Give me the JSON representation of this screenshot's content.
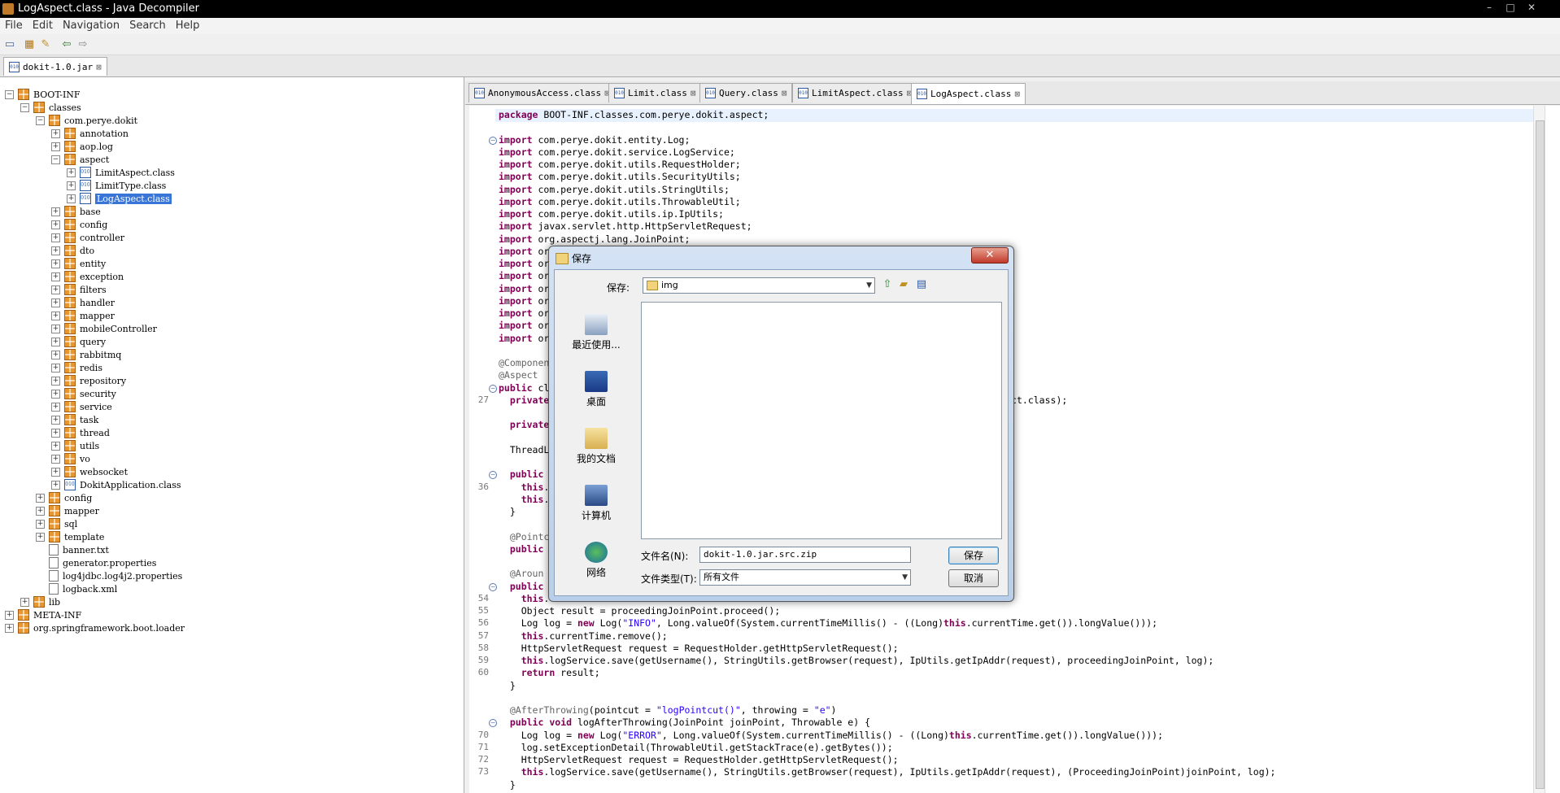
{
  "window": {
    "title": "LogAspect.class - Java Decompiler"
  },
  "menu": [
    "File",
    "Edit",
    "Navigation",
    "Search",
    "Help"
  ],
  "jar_tab": {
    "label": "dokit-1.0.jar"
  },
  "tree": [
    {
      "label": "BOOT-INF",
      "level": 0,
      "expanded": true,
      "kind": "package"
    },
    {
      "label": "classes",
      "level": 1,
      "expanded": true,
      "kind": "package"
    },
    {
      "label": "com.perye.dokit",
      "level": 2,
      "expanded": true,
      "kind": "package"
    },
    {
      "label": "annotation",
      "level": 3,
      "expanded": false,
      "kind": "package"
    },
    {
      "label": "aop.log",
      "level": 3,
      "expanded": false,
      "kind": "package"
    },
    {
      "label": "aspect",
      "level": 3,
      "expanded": true,
      "kind": "package"
    },
    {
      "label": "LimitAspect.class",
      "level": 4,
      "expanded": false,
      "kind": "class"
    },
    {
      "label": "LimitType.class",
      "level": 4,
      "expanded": false,
      "kind": "class"
    },
    {
      "label": "LogAspect.class",
      "level": 4,
      "expanded": false,
      "kind": "class",
      "selected": true
    },
    {
      "label": "base",
      "level": 3,
      "expanded": false,
      "kind": "package"
    },
    {
      "label": "config",
      "level": 3,
      "expanded": false,
      "kind": "package"
    },
    {
      "label": "controller",
      "level": 3,
      "expanded": false,
      "kind": "package"
    },
    {
      "label": "dto",
      "level": 3,
      "expanded": false,
      "kind": "package"
    },
    {
      "label": "entity",
      "level": 3,
      "expanded": false,
      "kind": "package"
    },
    {
      "label": "exception",
      "level": 3,
      "expanded": false,
      "kind": "package"
    },
    {
      "label": "filters",
      "level": 3,
      "expanded": false,
      "kind": "package"
    },
    {
      "label": "handler",
      "level": 3,
      "expanded": false,
      "kind": "package"
    },
    {
      "label": "mapper",
      "level": 3,
      "expanded": false,
      "kind": "package"
    },
    {
      "label": "mobileController",
      "level": 3,
      "expanded": false,
      "kind": "package"
    },
    {
      "label": "query",
      "level": 3,
      "expanded": false,
      "kind": "package"
    },
    {
      "label": "rabbitmq",
      "level": 3,
      "expanded": false,
      "kind": "package"
    },
    {
      "label": "redis",
      "level": 3,
      "expanded": false,
      "kind": "package"
    },
    {
      "label": "repository",
      "level": 3,
      "expanded": false,
      "kind": "package"
    },
    {
      "label": "security",
      "level": 3,
      "expanded": false,
      "kind": "package"
    },
    {
      "label": "service",
      "level": 3,
      "expanded": false,
      "kind": "package"
    },
    {
      "label": "task",
      "level": 3,
      "expanded": false,
      "kind": "package"
    },
    {
      "label": "thread",
      "level": 3,
      "expanded": false,
      "kind": "package"
    },
    {
      "label": "utils",
      "level": 3,
      "expanded": false,
      "kind": "package"
    },
    {
      "label": "vo",
      "level": 3,
      "expanded": false,
      "kind": "package"
    },
    {
      "label": "websocket",
      "level": 3,
      "expanded": false,
      "kind": "package"
    },
    {
      "label": "DokitApplication.class",
      "level": 3,
      "expanded": false,
      "kind": "class"
    },
    {
      "label": "config",
      "level": 2,
      "expanded": false,
      "kind": "package"
    },
    {
      "label": "mapper",
      "level": 2,
      "expanded": false,
      "kind": "package"
    },
    {
      "label": "sql",
      "level": 2,
      "expanded": false,
      "kind": "package"
    },
    {
      "label": "template",
      "level": 2,
      "expanded": false,
      "kind": "package"
    },
    {
      "label": "banner.txt",
      "level": 2,
      "kind": "file"
    },
    {
      "label": "generator.properties",
      "level": 2,
      "kind": "file"
    },
    {
      "label": "log4jdbc.log4j2.properties",
      "level": 2,
      "kind": "file"
    },
    {
      "label": "logback.xml",
      "level": 2,
      "kind": "file"
    },
    {
      "label": "lib",
      "level": 1,
      "expanded": false,
      "kind": "package"
    },
    {
      "label": "META-INF",
      "level": 0,
      "expanded": false,
      "kind": "package"
    },
    {
      "label": "org.springframework.boot.loader",
      "level": 0,
      "expanded": false,
      "kind": "package"
    }
  ],
  "editor_tabs": [
    {
      "label": "AnonymousAccess.class",
      "active": false
    },
    {
      "label": "Limit.class",
      "active": false
    },
    {
      "label": "Query.class",
      "active": false
    },
    {
      "label": "LimitAspect.class",
      "active": false
    },
    {
      "label": "LogAspect.class",
      "active": true
    }
  ],
  "code": [
    {
      "ln": "",
      "fold": false,
      "text": "package BOOT-INF.classes.com.perye.dokit.aspect;"
    },
    {
      "ln": "",
      "fold": false,
      "text": ""
    },
    {
      "ln": "",
      "fold": true,
      "text": "import com.perye.dokit.entity.Log;"
    },
    {
      "ln": "",
      "fold": false,
      "text": "import com.perye.dokit.service.LogService;"
    },
    {
      "ln": "",
      "fold": false,
      "text": "import com.perye.dokit.utils.RequestHolder;"
    },
    {
      "ln": "",
      "fold": false,
      "text": "import com.perye.dokit.utils.SecurityUtils;"
    },
    {
      "ln": "",
      "fold": false,
      "text": "import com.perye.dokit.utils.StringUtils;"
    },
    {
      "ln": "",
      "fold": false,
      "text": "import com.perye.dokit.utils.ThrowableUtil;"
    },
    {
      "ln": "",
      "fold": false,
      "text": "import com.perye.dokit.utils.ip.IpUtils;"
    },
    {
      "ln": "",
      "fold": false,
      "text": "import javax.servlet.http.HttpServletRequest;"
    },
    {
      "ln": "",
      "fold": false,
      "text": "import org.aspectj.lang.JoinPoint;"
    },
    {
      "ln": "",
      "fold": false,
      "text": "import or"
    },
    {
      "ln": "",
      "fold": false,
      "text": "import or"
    },
    {
      "ln": "",
      "fold": false,
      "text": "import or"
    },
    {
      "ln": "",
      "fold": false,
      "text": "import or"
    },
    {
      "ln": "",
      "fold": false,
      "text": "import or"
    },
    {
      "ln": "",
      "fold": false,
      "text": "import or"
    },
    {
      "ln": "",
      "fold": false,
      "text": "import or"
    },
    {
      "ln": "",
      "fold": false,
      "text": "import or"
    },
    {
      "ln": "",
      "fold": false,
      "text": ""
    },
    {
      "ln": "",
      "fold": false,
      "text": "@Componen"
    },
    {
      "ln": "",
      "fold": false,
      "text": "@Aspect"
    },
    {
      "ln": "",
      "fold": true,
      "text": "public cl"
    },
    {
      "ln": "27",
      "fold": false,
      "text": "  private                                                                                  ct.class);"
    },
    {
      "ln": "",
      "fold": false,
      "text": ""
    },
    {
      "ln": "",
      "fold": false,
      "text": "  private"
    },
    {
      "ln": "",
      "fold": false,
      "text": ""
    },
    {
      "ln": "",
      "fold": false,
      "text": "  ThreadL"
    },
    {
      "ln": "",
      "fold": false,
      "text": ""
    },
    {
      "ln": "",
      "fold": true,
      "text": "  public"
    },
    {
      "ln": "36",
      "fold": false,
      "text": "    this."
    },
    {
      "ln": "",
      "fold": false,
      "text": "    this."
    },
    {
      "ln": "",
      "fold": false,
      "text": "  }"
    },
    {
      "ln": "",
      "fold": false,
      "text": ""
    },
    {
      "ln": "",
      "fold": false,
      "text": "  @Pointc"
    },
    {
      "ln": "",
      "fold": false,
      "text": "  public"
    },
    {
      "ln": "",
      "fold": false,
      "text": ""
    },
    {
      "ln": "",
      "fold": false,
      "text": "  @Aroun"
    },
    {
      "ln": "",
      "fold": true,
      "text": "  public"
    },
    {
      "ln": "54",
      "fold": false,
      "text": "    this."
    },
    {
      "ln": "55",
      "fold": false,
      "text": "    Object result = proceedingJoinPoint.proceed();"
    },
    {
      "ln": "56",
      "fold": false,
      "text": "    Log log = new Log(\"INFO\", Long.valueOf(System.currentTimeMillis() - ((Long)this.currentTime.get()).longValue()));"
    },
    {
      "ln": "57",
      "fold": false,
      "text": "    this.currentTime.remove();"
    },
    {
      "ln": "58",
      "fold": false,
      "text": "    HttpServletRequest request = RequestHolder.getHttpServletRequest();"
    },
    {
      "ln": "59",
      "fold": false,
      "text": "    this.logService.save(getUsername(), StringUtils.getBrowser(request), IpUtils.getIpAddr(request), proceedingJoinPoint, log);"
    },
    {
      "ln": "60",
      "fold": false,
      "text": "    return result;"
    },
    {
      "ln": "",
      "fold": false,
      "text": "  }"
    },
    {
      "ln": "",
      "fold": false,
      "text": ""
    },
    {
      "ln": "",
      "fold": false,
      "text": "  @AfterThrowing(pointcut = \"logPointcut()\", throwing = \"e\")"
    },
    {
      "ln": "",
      "fold": true,
      "text": "  public void logAfterThrowing(JoinPoint joinPoint, Throwable e) {"
    },
    {
      "ln": "70",
      "fold": false,
      "text": "    Log log = new Log(\"ERROR\", Long.valueOf(System.currentTimeMillis() - ((Long)this.currentTime.get()).longValue()));"
    },
    {
      "ln": "71",
      "fold": false,
      "text": "    log.setExceptionDetail(ThrowableUtil.getStackTrace(e).getBytes());"
    },
    {
      "ln": "72",
      "fold": false,
      "text": "    HttpServletRequest request = RequestHolder.getHttpServletRequest();"
    },
    {
      "ln": "73",
      "fold": false,
      "text": "    this.logService.save(getUsername(), StringUtils.getBrowser(request), IpUtils.getIpAddr(request), (ProceedingJoinPoint)joinPoint, log);"
    },
    {
      "ln": "",
      "fold": false,
      "text": "  }"
    }
  ],
  "dialog": {
    "title": "保存",
    "close_label": "✕",
    "save_in_label": "保存:",
    "folder": "img",
    "places": [
      "最近使用...",
      "桌面",
      "我的文档",
      "计算机",
      "网络"
    ],
    "filename_label": "文件名(N):",
    "filename_value": "dokit-1.0.jar.src.zip",
    "filetype_label": "文件类型(T):",
    "filetype_value": "所有文件",
    "save_button": "保存",
    "cancel_button": "取消"
  }
}
